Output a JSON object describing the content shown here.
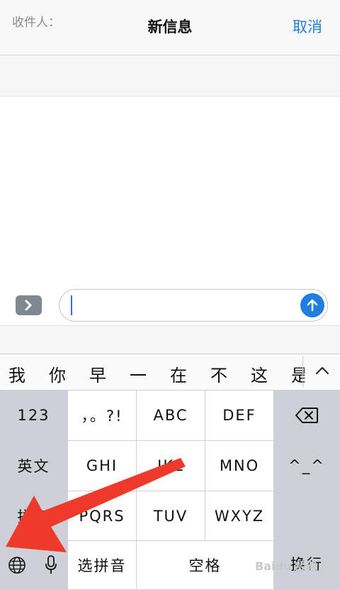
{
  "nav": {
    "title": "新信息",
    "cancel": "取消"
  },
  "recipient": {
    "label": "收件人："
  },
  "compose": {
    "message_text": ""
  },
  "candidates": [
    "我",
    "你",
    "早",
    "一",
    "在",
    "不",
    "这",
    "是"
  ],
  "keyboard": {
    "k123": "123",
    "punct": "，。?!",
    "abc": "ABC",
    "def": "DEF",
    "english": "英文",
    "ghi": "GHI",
    "jkl": "JKL",
    "mno": "MNO",
    "emoji": "^_^",
    "pinyin": "拼音",
    "pqrs": "PQRS",
    "tuv": "TUV",
    "wxyz": "WXYZ",
    "newline": "换行",
    "select_pinyin": "选拼音",
    "space": "空格"
  },
  "icons": {
    "expand": "chevron-right-icon",
    "send": "arrow-up-icon",
    "collapse": "chevron-up-icon",
    "backspace": "backspace-icon",
    "globe": "globe-icon",
    "mic": "microphone-icon"
  },
  "colors": {
    "accent": "#1f7ee0",
    "arrow": "#ee3a2a",
    "dark_key": "#cdd0d6"
  },
  "watermark": "Baidu 经验"
}
